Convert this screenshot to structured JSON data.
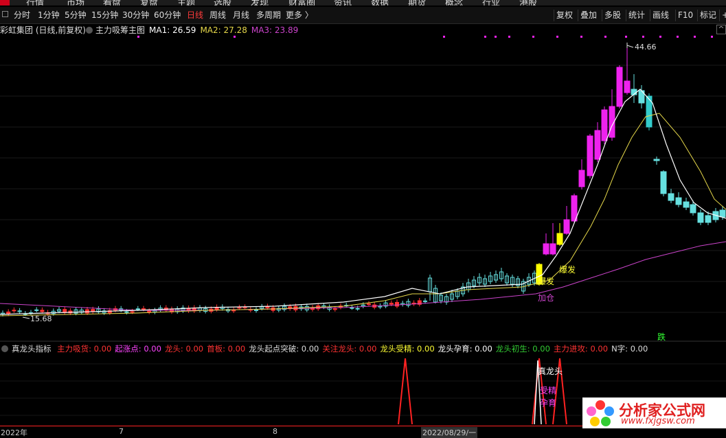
{
  "nav": {
    "items": [
      "行情",
      "市场",
      "看盘",
      "复盘",
      "主题",
      "选股",
      "发现",
      "财富圈",
      "资讯",
      "数据",
      "期货",
      "概念",
      "行业",
      "港股"
    ]
  },
  "toolbar": {
    "periods": [
      "分时",
      "1分钟",
      "5分钟",
      "15分钟",
      "30分钟",
      "60分钟",
      "日线",
      "周线",
      "月线",
      "多周期",
      "更多 〉"
    ],
    "active_period": "日线",
    "right_buttons": [
      "复权",
      "叠加",
      "多股",
      "统计",
      "画线",
      "F10",
      "标记",
      "+"
    ]
  },
  "main_legend": {
    "stock": "彩虹集团 (日线,前复权)",
    "indicator": "主力吸筹主图",
    "ma1": "MA1: 26.59",
    "ma2": "MA2: 27.28",
    "ma3": "MA3: 23.89"
  },
  "annotations": {
    "high": "44.66",
    "low": "15.68",
    "baofa_a": "爆发",
    "baofa_b": "爆发",
    "jiacang": "加仓",
    "die": "跌"
  },
  "indicator_panel": {
    "name": "真龙头指标",
    "fields": [
      {
        "label": "主力吸货: 0.00",
        "color": "#ff3333"
      },
      {
        "label": "起涨点: 0.00",
        "color": "#ff44ff"
      },
      {
        "label": "龙头: 0.00",
        "color": "#ff3333"
      },
      {
        "label": "首板: 0.00",
        "color": "#ff3333"
      },
      {
        "label": "龙头起点突破: 0.00",
        "color": "#dddddd"
      },
      {
        "label": "关注龙头: 0.00",
        "color": "#ff3333"
      },
      {
        "label": "龙头受精: 0.00",
        "color": "#ffff33"
      },
      {
        "label": "龙头孕育: 0.00",
        "color": "#ffffff"
      },
      {
        "label": "龙头初生: 0.00",
        "color": "#33cc33"
      },
      {
        "label": "主力进攻: 0.00",
        "color": "#ff3333"
      },
      {
        "label": "N字: 0.00",
        "color": "#dddddd"
      }
    ],
    "labels": {
      "zhen": "真龙头",
      "shoujing": "受精",
      "yunyu": "孕育"
    }
  },
  "x_axis": {
    "labels": [
      "2022年",
      "7",
      "8",
      "2022/08/29/一"
    ]
  },
  "watermark": {
    "title": "分析家公式网",
    "url": "www.fxjgsw.com"
  },
  "colors": {
    "up": "#ff3333",
    "down": "#66e0e0",
    "ma1": "#ffffff",
    "ma2": "#e6d84a",
    "ma3": "#cc44cc",
    "limit": "#ee22ee",
    "signal": "#ffff00"
  }
}
